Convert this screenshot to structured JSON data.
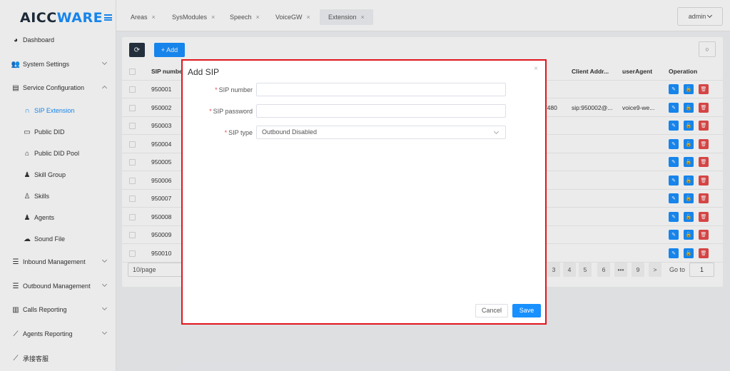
{
  "app": {
    "logo_part1": "AICC",
    "logo_part2": "WARE"
  },
  "header": {
    "tabs": [
      {
        "label": "Areas"
      },
      {
        "label": "SysModules"
      },
      {
        "label": "Speech"
      },
      {
        "label": "VoiceGW"
      },
      {
        "label": "Extension"
      }
    ],
    "close_glyph": "×",
    "user": "admin"
  },
  "sidebar": {
    "items": [
      {
        "label": "Dashboard",
        "icon": "dashboard-icon"
      },
      {
        "label": "System Settings",
        "icon": "users-icon"
      },
      {
        "label": "Service Configuration",
        "icon": "id-card-icon"
      },
      {
        "label": "SIP Extension",
        "icon": "headset-icon"
      },
      {
        "label": "Public DID",
        "icon": "folder-icon"
      },
      {
        "label": "Public DID Pool",
        "icon": "home-icon"
      },
      {
        "label": "Skill Group",
        "icon": "user-group-icon"
      },
      {
        "label": "Skills",
        "icon": "user-outline-icon"
      },
      {
        "label": "Agents",
        "icon": "user-icon"
      },
      {
        "label": "Sound File",
        "icon": "cloud-icon"
      },
      {
        "label": "Inbound Management",
        "icon": "list-icon"
      },
      {
        "label": "Outbound Management",
        "icon": "list-icon"
      },
      {
        "label": "Calls Reporting",
        "icon": "bar-chart-icon"
      },
      {
        "label": "Agents Reporting",
        "icon": "line-chart-icon"
      },
      {
        "label": "承接客服",
        "icon": "line-chart-icon"
      }
    ]
  },
  "toolbar": {
    "add_label": "+ Add",
    "refresh_glyph": "⟳",
    "search_glyph": "○"
  },
  "table": {
    "headers": {
      "sip_number": "SIP numbe",
      "client_addr": "Client Addr...",
      "user_agent": "userAgent",
      "operation": "Operation"
    },
    "rows": [
      {
        "sip": "950001",
        "mid": "",
        "client": "",
        "agent": ""
      },
      {
        "sip": "950002",
        "mid": "'480",
        "client": "sip:950002@...",
        "agent": "voice9-we..."
      },
      {
        "sip": "950003",
        "mid": "",
        "client": "",
        "agent": ""
      },
      {
        "sip": "950004",
        "mid": "",
        "client": "",
        "agent": ""
      },
      {
        "sip": "950005",
        "mid": "",
        "client": "",
        "agent": ""
      },
      {
        "sip": "950006",
        "mid": "",
        "client": "",
        "agent": ""
      },
      {
        "sip": "950007",
        "mid": "",
        "client": "",
        "agent": ""
      },
      {
        "sip": "950008",
        "mid": "",
        "client": "",
        "agent": ""
      },
      {
        "sip": "950009",
        "mid": "",
        "client": "",
        "agent": ""
      },
      {
        "sip": "950010",
        "mid": "",
        "client": "",
        "agent": ""
      }
    ],
    "op_icons": {
      "edit": "✎",
      "lock": "🔓",
      "delete": "🗑"
    }
  },
  "pagination": {
    "page_size": "10/page",
    "pages": [
      "3",
      "4",
      "5",
      "6",
      "•••",
      "9",
      ">"
    ],
    "goto_label": "Go to",
    "goto_value": "1"
  },
  "modal": {
    "title": "Add SIP",
    "close_glyph": "×",
    "required_mark": "*",
    "fields": {
      "sip_number_label": "SIP number",
      "sip_number_value": "",
      "sip_password_label": "SIP password",
      "sip_password_value": "",
      "sip_type_label": "SIP type",
      "sip_type_value": "Outbound Disabled"
    },
    "cancel_label": "Cancel",
    "save_label": "Save"
  }
}
